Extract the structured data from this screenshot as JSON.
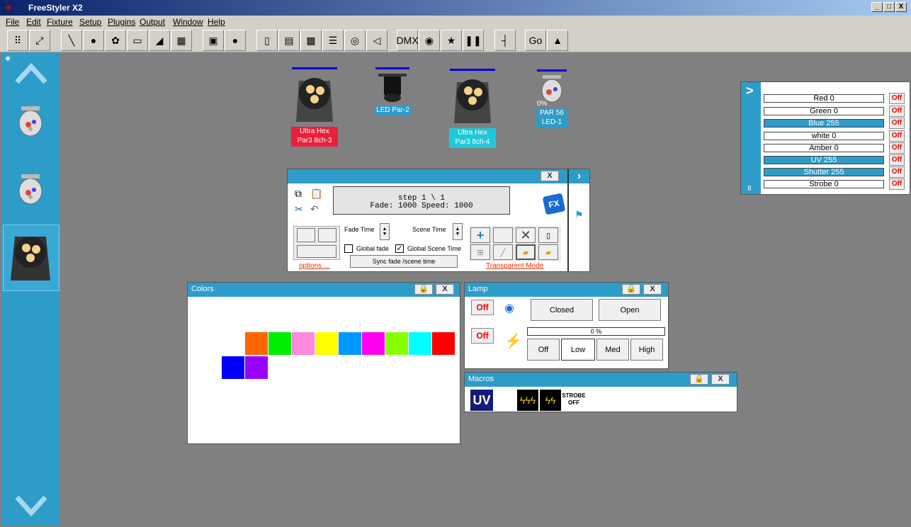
{
  "window": {
    "title": "FreeStyler X2",
    "min": "_",
    "max": "□",
    "close": "X"
  },
  "menu": [
    "File",
    "Edit",
    "Fixture",
    "Setup",
    "Plugins",
    "Output",
    "Window",
    "Help"
  ],
  "fixtures": [
    {
      "line1": "Ultra Hex",
      "line2": "Par3  8ch-3"
    },
    {
      "line1": "LED Par-2",
      "line2": ""
    },
    {
      "line1": "Ultra Hex",
      "line2": "Par3  8ch-4"
    },
    {
      "pct": "0%",
      "line1": "PAR 56",
      "line2": "LED-1"
    }
  ],
  "sequence": {
    "line1": "step 1 \\ 1",
    "line2": "Fade: 1000  Speed: 1000",
    "fade_time": "Fade Time",
    "scene_time": "Scene Time",
    "global_fade": "Global fade",
    "global_scene": "Global Scene Time",
    "sync": "Sync fade /scene time",
    "options": "options ...",
    "transparent": "Transparent Mode",
    "fx": "FX"
  },
  "colors": {
    "title": "Colors",
    "swatches_row1": [
      "#ff6600",
      "#00ee00",
      "#ff88dd",
      "#ffff00",
      "#0099ff",
      "#ff00ee",
      "#88ff00",
      "#00ffff",
      "#ff0000"
    ],
    "swatches_row2": [
      "#0000ff",
      "#9900ff"
    ]
  },
  "lamp": {
    "title": "Lamp",
    "off1": "Off",
    "off2": "Off",
    "closed": "Closed",
    "open": "Open",
    "progress": "0 %",
    "modes": [
      "Off",
      "Low",
      "Med",
      "High"
    ]
  },
  "macros": {
    "title": "Macros",
    "uv": "UV",
    "strobe1": "STROBE",
    "strobe2": "OFF"
  },
  "channels": {
    "index": "8",
    "arrow": ">",
    "rows": [
      {
        "label": "Red     0",
        "active": false
      },
      {
        "label": "Green     0",
        "active": false
      },
      {
        "label": "Blue     255",
        "active": true
      },
      {
        "label": "white     0",
        "active": false
      },
      {
        "label": "Amber     0",
        "active": false
      },
      {
        "label": "UV     255",
        "active": true
      },
      {
        "label": "Shutter     255",
        "active": true
      },
      {
        "label": "Strobe     0",
        "active": false
      }
    ],
    "off": "Off"
  },
  "accent": "#2e9cc8"
}
